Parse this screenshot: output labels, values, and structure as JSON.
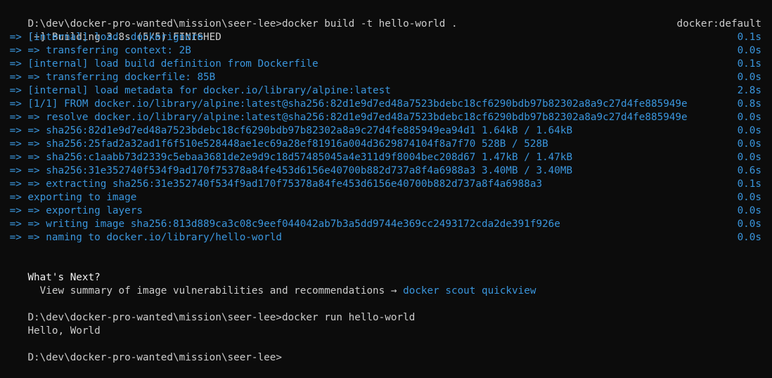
{
  "terminal": {
    "cmd1": "D:\\dev\\docker-pro-wanted\\mission\\seer-lee>docker build -t hello-world .",
    "building": "[+] Building 3.8s (5/5) FINISHED",
    "builder": "docker:default",
    "steps": [
      {
        "text": " => [internal] load .dockerignore",
        "time": "0.1s"
      },
      {
        "text": " => => transferring context: 2B",
        "time": "0.0s"
      },
      {
        "text": " => [internal] load build definition from Dockerfile",
        "time": "0.1s"
      },
      {
        "text": " => => transferring dockerfile: 85B",
        "time": "0.0s"
      },
      {
        "text": " => [internal] load metadata for docker.io/library/alpine:latest",
        "time": "2.8s"
      },
      {
        "text": " => [1/1] FROM docker.io/library/alpine:latest@sha256:82d1e9d7ed48a7523bdebc18cf6290bdb97b82302a8a9c27d4fe885949e",
        "time": "0.8s"
      },
      {
        "text": " => => resolve docker.io/library/alpine:latest@sha256:82d1e9d7ed48a7523bdebc18cf6290bdb97b82302a8a9c27d4fe885949e",
        "time": "0.0s"
      },
      {
        "text": " => => sha256:82d1e9d7ed48a7523bdebc18cf6290bdb97b82302a8a9c27d4fe885949ea94d1 1.64kB / 1.64kB",
        "time": "0.0s"
      },
      {
        "text": " => => sha256:25fad2a32ad1f6f510e528448ae1ec69a28ef81916a004d3629874104f8a7f70 528B / 528B",
        "time": "0.0s"
      },
      {
        "text": " => => sha256:c1aabb73d2339c5ebaa3681de2e9d9c18d57485045a4e311d9f8004bec208d67 1.47kB / 1.47kB",
        "time": "0.0s"
      },
      {
        "text": " => => sha256:31e352740f534f9ad170f75378a84fe453d6156e40700b882d737a8f4a6988a3 3.40MB / 3.40MB",
        "time": "0.6s"
      },
      {
        "text": " => => extracting sha256:31e352740f534f9ad170f75378a84fe453d6156e40700b882d737a8f4a6988a3",
        "time": "0.1s"
      },
      {
        "text": " => exporting to image",
        "time": "0.0s"
      },
      {
        "text": " => => exporting layers",
        "time": "0.0s"
      },
      {
        "text": " => => writing image sha256:813d889ca3c08c9eef044042ab7b3a5dd9744e369cc2493172cda2de391f926e",
        "time": "0.0s"
      },
      {
        "text": " => => naming to docker.io/library/hello-world",
        "time": "0.0s"
      }
    ],
    "whats_next": "What's Next?",
    "view_summary": "  View summary of image vulnerabilities and recommendations → ",
    "scout_cmd": "docker scout quickview",
    "cmd2": "D:\\dev\\docker-pro-wanted\\mission\\seer-lee>docker run hello-world",
    "output": "Hello, World",
    "prompt": "D:\\dev\\docker-pro-wanted\\mission\\seer-lee>"
  }
}
